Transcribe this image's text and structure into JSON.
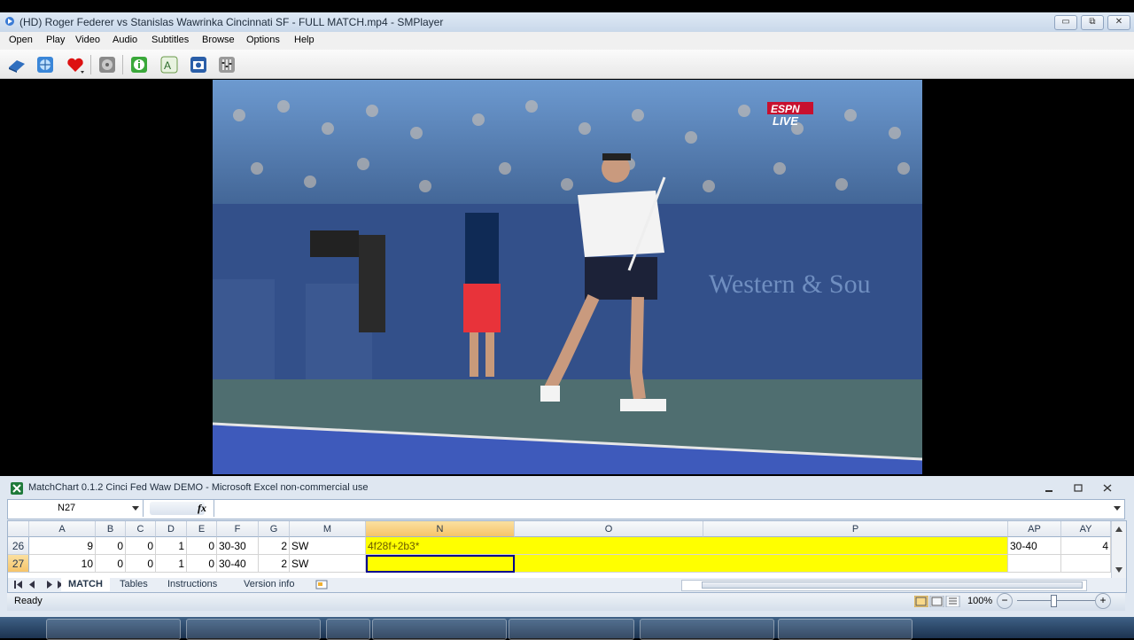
{
  "player": {
    "title": "(HD) Roger Federer vs Stanislas Wawrinka Cincinnati SF - FULL MATCH.mp4 - SMPlayer",
    "window_buttons": {
      "minimize": "▭",
      "restore": "⧉",
      "close": "✕"
    },
    "menu": [
      "Open",
      "Play",
      "Video",
      "Audio",
      "Subtitles",
      "Browse",
      "Options",
      "Help"
    ],
    "toolbar_icons": [
      "open-file-icon",
      "globe-icon",
      "favorites-heart-icon",
      "eject-disc-icon",
      "info-icon",
      "subtitle-icon",
      "screenshot-camera-icon",
      "equalizer-icon"
    ],
    "video_overlay": {
      "network": "ESPN",
      "status": "LIVE",
      "banner": "Western & Sou"
    }
  },
  "excel": {
    "title": "MatchChart 0.1.2 Cinci Fed Waw DEMO - Microsoft Excel non-commercial use",
    "name_box": "N27",
    "fx": "fx",
    "formula": "",
    "columns": [
      "A",
      "B",
      "C",
      "D",
      "E",
      "F",
      "G",
      "M",
      "N",
      "O",
      "P",
      "AP",
      "AY"
    ],
    "rows": [
      {
        "num": "26",
        "A": "9",
        "B": "0",
        "C": "0",
        "D": "1",
        "E": "0",
        "F": "30-30",
        "G": "2",
        "M": "SW",
        "N": "4f28f+2b3*",
        "AP": "30-40",
        "AY": "4"
      },
      {
        "num": "27",
        "A": "10",
        "B": "0",
        "C": "0",
        "D": "1",
        "E": "0",
        "F": "30-40",
        "G": "2",
        "M": "SW",
        "N": "",
        "AP": "",
        "AY": ""
      }
    ],
    "sheet_tabs": [
      "MATCH",
      "Tables",
      "Instructions",
      "Version info"
    ],
    "active_tab": "MATCH",
    "status": "Ready",
    "zoom": "100%",
    "zoom_minus": "−",
    "zoom_plus": "+",
    "colors": {
      "highlight": "#ffff00",
      "selection_border": "#00008b"
    }
  }
}
